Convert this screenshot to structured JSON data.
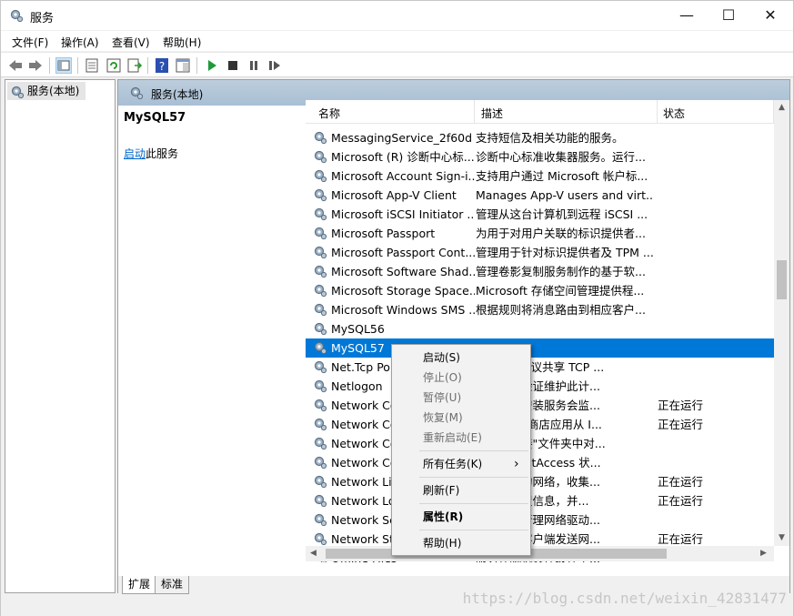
{
  "window": {
    "title": "服务",
    "minimize": "—",
    "maximize": "☐",
    "close": "✕"
  },
  "menu": [
    "文件(F)",
    "操作(A)",
    "查看(V)",
    "帮助(H)"
  ],
  "tree": {
    "item": "服务(本地)"
  },
  "pane_header": "服务(本地)",
  "detail": {
    "title": "MySQL57",
    "link": "启动",
    "link_suffix": "此服务"
  },
  "columns": {
    "name": "名称",
    "desc": "描述",
    "status": "状态",
    "sort_arrow": "^"
  },
  "rows": [
    {
      "name": "MessagingService_2f60d",
      "desc": "支持短信及相关功能的服务。",
      "status": ""
    },
    {
      "name": "Microsoft (R) 诊断中心标...",
      "desc": "诊断中心标准收集器服务。运行...",
      "status": ""
    },
    {
      "name": "Microsoft Account Sign-i...",
      "desc": "支持用户通过 Microsoft 帐户标...",
      "status": ""
    },
    {
      "name": "Microsoft App-V Client",
      "desc": "Manages App-V users and virt...",
      "status": ""
    },
    {
      "name": "Microsoft iSCSI Initiator ...",
      "desc": "管理从这台计算机到远程 iSCSI ...",
      "status": ""
    },
    {
      "name": "Microsoft Passport",
      "desc": "为用于对用户关联的标识提供者...",
      "status": ""
    },
    {
      "name": "Microsoft Passport Cont...",
      "desc": "管理用于针对标识提供者及 TPM ...",
      "status": ""
    },
    {
      "name": "Microsoft Software Shad...",
      "desc": "管理卷影复制服务制作的基于软...",
      "status": ""
    },
    {
      "name": "Microsoft Storage Space...",
      "desc": "Microsoft 存储空间管理提供程...",
      "status": ""
    },
    {
      "name": "Microsoft Windows SMS ...",
      "desc": "根据规则将消息路由到相应客户...",
      "status": ""
    },
    {
      "name": "MySQL56",
      "desc": "",
      "status": ""
    },
    {
      "name": "MySQL57",
      "desc": "",
      "status": ""
    },
    {
      "name": "Net.Tcp Por",
      "desc": "net.tcp 协议共享 TCP ...",
      "status": ""
    },
    {
      "name": "Netlogon",
      "desc": "服务身份验证维护此计...",
      "status": ""
    },
    {
      "name": "Network Co",
      "desc": "设备自动安装服务会监...",
      "status": "正在运行"
    },
    {
      "name": "Network Co",
      "desc": "lows 应用商店应用从 I...",
      "status": "正在运行"
    },
    {
      "name": "Network Co",
      "desc": "和拨号连接\"文件夹中对...",
      "status": ""
    },
    {
      "name": "Network Co",
      "desc": "件的 DirectAccess 状...",
      "status": ""
    },
    {
      "name": "Network Lis",
      "desc": "机已连接的网络，收集...",
      "status": "正在运行"
    },
    {
      "name": "Network Lo",
      "desc": "网络的配置信息，并...",
      "status": "正在运行"
    },
    {
      "name": "Network Se",
      "desc": "服务用于管理网络驱动...",
      "status": ""
    },
    {
      "name": "Network St",
      "desc": "用户模式客户端发送网...",
      "status": "正在运行"
    },
    {
      "name": "Offline Files",
      "desc": "服务在脱机文件缓存中...",
      "status": ""
    }
  ],
  "context_menu": {
    "start": "启动(S)",
    "stop": "停止(O)",
    "pause": "暂停(U)",
    "resume": "恢复(M)",
    "restart": "重新启动(E)",
    "all_tasks": "所有任务(K)",
    "submenu_arrow": "›",
    "refresh": "刷新(F)",
    "properties": "属性(R)",
    "help": "帮助(H)"
  },
  "tabs": [
    "扩展",
    "标准"
  ],
  "watermark": "https://blog.csdn.net/weixin_42831477",
  "colors": {
    "selection": "#0078d7",
    "header": "#a9bfd4",
    "link": "#0066cc"
  }
}
